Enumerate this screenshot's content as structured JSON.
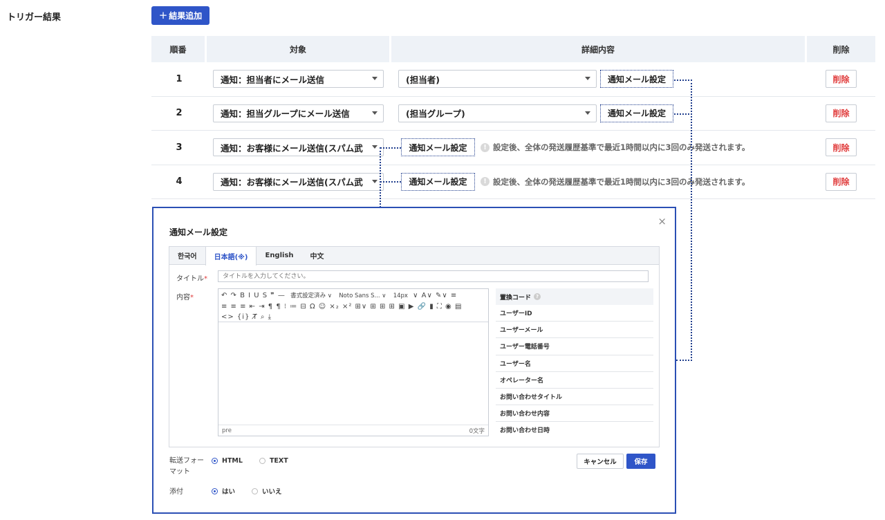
{
  "section": {
    "label": "トリガー結果",
    "add_button": "結果追加",
    "add_icon": "+"
  },
  "table": {
    "headers": [
      "順番",
      "対象",
      "詳細内容",
      "削除"
    ],
    "rows": [
      {
        "order": "1",
        "target": "通知：担当者にメール送信",
        "detail_select": "(担当者)",
        "mail_button": "通知メール設定",
        "delete": "削除"
      },
      {
        "order": "2",
        "target": "通知：担当グループにメール送信",
        "detail_select": "(担当グループ)",
        "mail_button": "通知メール設定",
        "delete": "削除"
      },
      {
        "order": "3",
        "target": "通知：お客様にメール送信(スパム武",
        "mail_button": "通知メール設定",
        "note": "設定後、全体の発送履歴基準で最近1時間以内に3回のみ発送されます。",
        "delete": "削除"
      },
      {
        "order": "4",
        "target": "通知：お客様にメール送信(スパム武",
        "mail_button": "通知メール設定",
        "note": "設定後、全体の発送履歴基準で最近1時間以内に3回のみ発送されます。",
        "delete": "削除"
      }
    ]
  },
  "modal": {
    "title": "通知メール設定",
    "close": "×",
    "tabs": [
      "한국어",
      "日本語(※)",
      "English",
      "中文"
    ],
    "active_tab": 1,
    "title_label": "タイトル",
    "title_placeholder": "タイトルを入力してください。",
    "content_label": "内容",
    "required_mark": "*",
    "toolbar": {
      "row1_icons": "↶ ↷ B I U S ❞ —",
      "format": "書式設定済み ∨",
      "font": "Noto Sans S... ∨",
      "size": "14px",
      "row1_tail": "∨ A∨ ✎∨ ≡",
      "row2": "≡ ≡ ≡ ⇤ ⇥ ¶ ¶ ⁝ ≔ ⊟ Ω ☺ ×₂ ×² ⊞∨ ⊞ ⊞ ⊞ ▣ ▶ 🔗 ▮ ⛶ ◉ ▤",
      "row3": "<> {i} T̸ ⌕ ⤓"
    },
    "editor_status": "pre",
    "char_count": "0文字",
    "variables_header": "置換コード",
    "variables_help": "?",
    "variables": [
      "ユーザーID",
      "ユーザーメール",
      "ユーザー電話番号",
      "ユーザー名",
      "オペレーター名",
      "お問い合わせタイトル",
      "お問い合わせ内容",
      "お問い合わせ日時"
    ],
    "format_label": "転送フォーマット",
    "format_options": [
      "HTML",
      "TEXT"
    ],
    "attach_label": "添付",
    "attach_options": [
      "はい",
      "いいえ"
    ],
    "cancel": "キャンセル",
    "save": "保存"
  },
  "colors": {
    "primary": "#2f55c8",
    "danger": "#e03b3b",
    "connector": "#1e3c8c"
  }
}
